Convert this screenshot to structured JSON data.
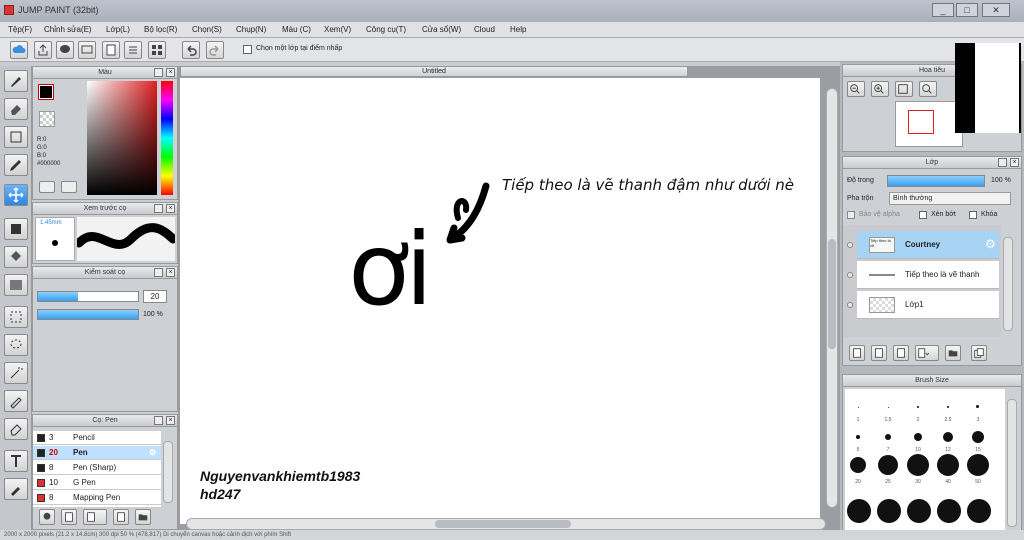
{
  "window": {
    "title": "JUMP PAINT (32bit)",
    "controls": [
      "_",
      "□",
      "✕"
    ]
  },
  "menu": [
    "Tệp(F)",
    "Chỉnh sửa(E)",
    "Lớp(L)",
    "Bộ lọc(R)",
    "Chọn(S)",
    "Chụp(N)",
    "Màu (C)",
    "Xem(V)",
    "Công cụ(T)",
    "Cửa sổ(W)",
    "Cloud",
    "Help"
  ],
  "toolbar": {
    "single_layer_checkbox": "Chọn một lớp tại điểm nhấp"
  },
  "color_panel": {
    "title": "Màu",
    "r": "R:0",
    "g": "G:0",
    "b": "B:0",
    "hex": "#000000",
    "current_color": "#000000"
  },
  "brush_preview_panel": {
    "title": "Xem trước cọ",
    "size_label": "1.45mm"
  },
  "brush_control_panel": {
    "title": "Kiểm soát cọ",
    "size_value": "20",
    "opacity_value": "100 %"
  },
  "brush_list_panel": {
    "title": "Cọ: Pen",
    "items": [
      {
        "size": "3",
        "name": "Pencil",
        "color": "#222222"
      },
      {
        "size": "20",
        "name": "Pen",
        "color": "#222222"
      },
      {
        "size": "8",
        "name": "Pen (Sharp)",
        "color": "#222222"
      },
      {
        "size": "10",
        "name": "G Pen",
        "color": "#e03030"
      },
      {
        "size": "8",
        "name": "Mapping Pen",
        "color": "#e03030"
      }
    ]
  },
  "document": {
    "tab_title": "Untitled",
    "annotation_text": "Tiếp theo là vẽ thanh đậm như dưới nè",
    "handwritten_text": "ơi",
    "signature_line1": "Nguyenvankhiemtb1983",
    "signature_line2": "hd247"
  },
  "navigator_panel": {
    "title": "Hoa tiêu"
  },
  "layer_panel": {
    "title": "Lớp",
    "opacity_label": "Độ trong",
    "opacity_value": "100 %",
    "blend_label": "Pha trộn",
    "blend_value": "Bình thường",
    "protect_alpha": "Bảo vệ alpha",
    "clipping": "Xén bớt",
    "lock": "Khóa",
    "layers": [
      {
        "name": "Courtney",
        "thumb_text": "Tiếp theo là vẽ"
      },
      {
        "name": "Tiếp theo là vẽ thanh"
      },
      {
        "name": "Lớp1"
      }
    ]
  },
  "brush_size_panel": {
    "title": "Brush Size",
    "labels_row1": [
      "1",
      "1.5",
      "2",
      "2.5",
      "3"
    ],
    "labels_row2": [
      "5",
      "7",
      "10",
      "12",
      "15"
    ],
    "labels_row3": [
      "20",
      "25",
      "30",
      "40",
      "50"
    ]
  },
  "status": {
    "text": "2000 x 2000 pixels (21.2 x 14.8cm) 300 dpi 50 % (478,817) Di chuyển canvas hoặc cảnh dịch với phím Shift"
  }
}
